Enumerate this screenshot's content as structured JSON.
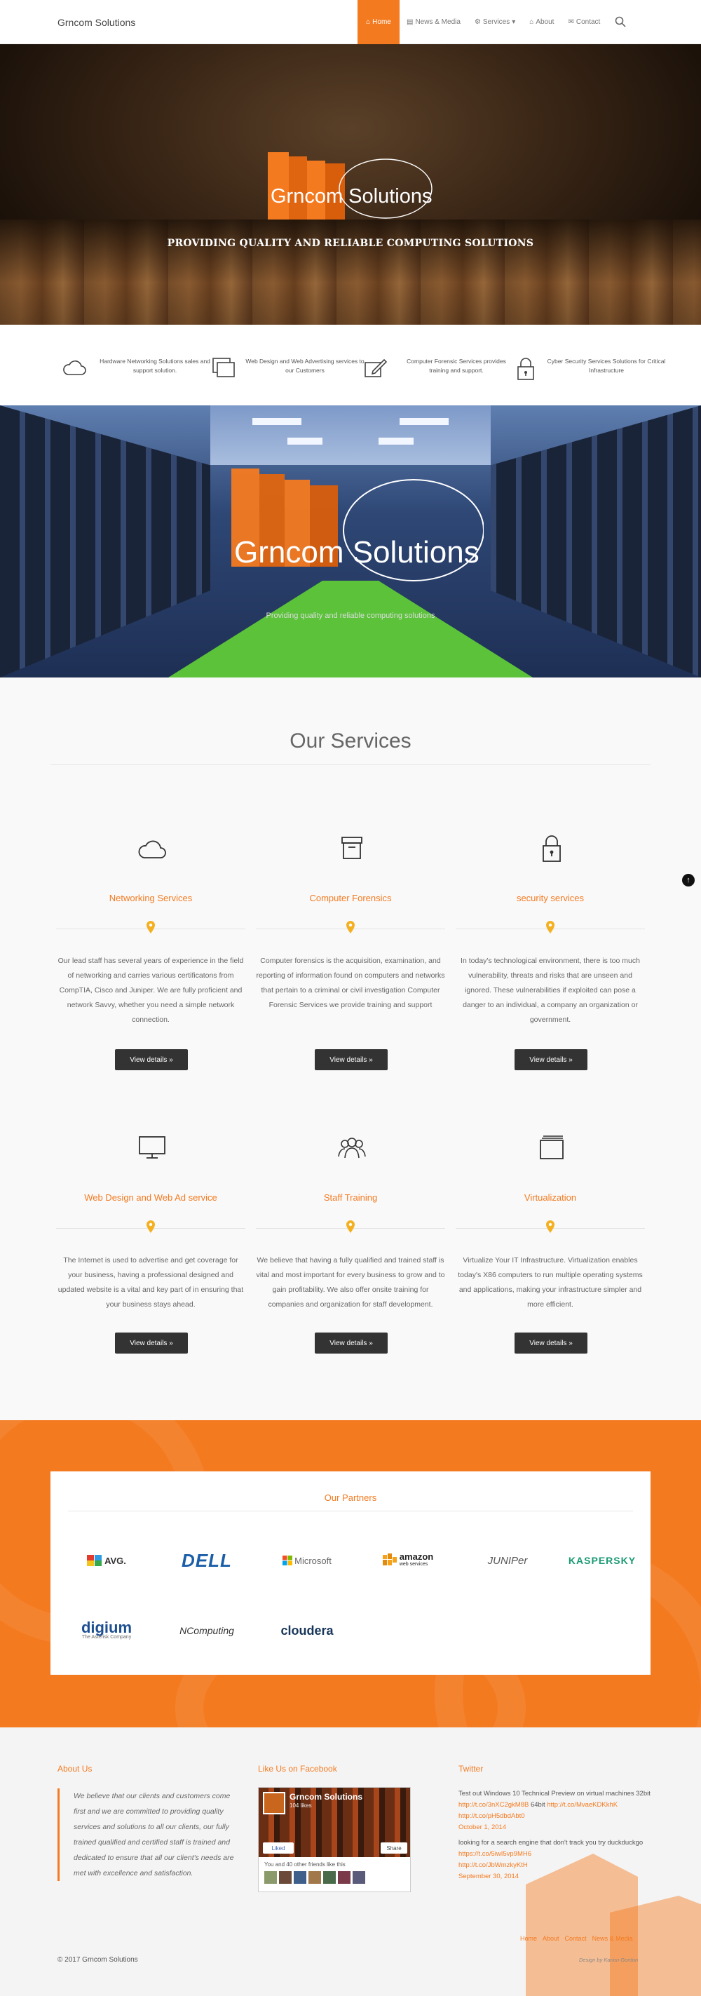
{
  "header": {
    "logo": "Grncom Solutions",
    "nav": [
      {
        "label": "Home",
        "icon": "home-icon",
        "active": true
      },
      {
        "label": "News & Media",
        "icon": "news-icon"
      },
      {
        "label": "Services",
        "icon": "gear-icon",
        "caret": "▾"
      },
      {
        "label": "About",
        "icon": "bank-icon"
      },
      {
        "label": "Contact",
        "icon": "envelope-icon"
      }
    ]
  },
  "hero1": {
    "brand": "Grncom Solutions",
    "tagline": "PROVIDING QUALITY AND RELIABLE COMPUTING SOLUTIONS"
  },
  "features": [
    {
      "icon": "cloud-icon",
      "text": "Hardware Networking Solutions sales and support solution."
    },
    {
      "icon": "windows-icon",
      "text": "Web Design and Web Advertising services to our Customers"
    },
    {
      "icon": "edit-icon",
      "text": "Computer Forensic Services provides training and support."
    },
    {
      "icon": "lock-icon",
      "text": "Cyber Security Services Solutions for Critical Infrastructure"
    }
  ],
  "hero2": {
    "brand": "Grncom Solutions",
    "tagline": "Providing quality and reliable computing solutions"
  },
  "services": {
    "title": "Our Services",
    "button_label": "View details »",
    "items": [
      {
        "icon": "cloud-icon",
        "title": "Networking Services",
        "desc": "Our lead staff has several years of experience in the field of networking and carries various certificatons from CompTIA, Cisco and Juniper. We are fully proficient and network Savvy, whether you need a simple network connection."
      },
      {
        "icon": "archive-icon",
        "title": "Computer Forensics",
        "desc": "Computer forensics is the acquisition, examination, and reporting of information found on computers and networks that pertain to a criminal or civil investigation Computer Forensic Services we provide training and support"
      },
      {
        "icon": "lock-icon",
        "title": "security services",
        "desc": "In today's technological environment, there is too much vulnerability, threats and risks that are unseen and ignored. These vulnerabilities if exploited can pose a danger to an individual, a company an organization or government."
      },
      {
        "icon": "monitor-icon",
        "title": "Web Design and Web Ad service",
        "desc": "The Internet is used to advertise and get coverage for your business, having a professional designed and updated website is a vital and key part of in ensuring that your business stays ahead."
      },
      {
        "icon": "users-icon",
        "title": "Staff Training",
        "desc": "We believe that having a fully qualified and trained staff is vital and most important for every business to grow and to gain profitability. We also offer onsite training for companies and organization for staff development."
      },
      {
        "icon": "windows-icon",
        "title": "Virtualization",
        "desc": "Virtualize Your IT Infrastructure. Virtualization enables today's X86 computers to run multiple operating systems and applications, making your infrastructure simpler and more efficient."
      }
    ]
  },
  "partners": {
    "title": "Our Partners",
    "logos": [
      "AVG.",
      "DELL",
      "Microsoft",
      "amazon",
      "web services",
      "JUNIPer",
      "KASPERSKY",
      "digium",
      "The Asterisk Company",
      "NComputing",
      "cloudera"
    ]
  },
  "footer": {
    "about_title": "About Us",
    "about_text": "We believe that our clients and customers come first and we are committed to providing quality services and solutions to all our clients, our fully trained qualified and certified staff is trained and dedicated to ensure that all our client's needs are met with excellence and satisfaction.",
    "facebook_title": "Like Us on Facebook",
    "facebook_page": "Grncom Solutions",
    "facebook_likes": "104 likes",
    "facebook_like_btn": "Liked",
    "facebook_share_btn": "Share",
    "facebook_friends": "You and 40 other friends like this",
    "twitter_title": "Twitter",
    "tweets": [
      {
        "text": "Test out Windows 10 Technical Preview on virtual machines 32bit",
        "link1": "http://t.co/3nXC2gkM8B",
        "mid": "64bit",
        "link2": "http://t.co/MvaeKDKkhK",
        "link3": "http://t.co/pH5dbdAbt0",
        "date": "October 1, 2014"
      },
      {
        "text": "looking for a search engine that don't track you try duckduckgo",
        "link1": "https://t.co/5iwI5vp9MH6",
        "link2": "http://t.co/JbWmzkyKtH",
        "date": "September 30, 2014"
      }
    ],
    "nav": [
      "Home",
      "About",
      "Contact",
      "News & Media"
    ],
    "design_by": "Design by Karion Gordon",
    "copyright": "© 2017 Grncom Solutions"
  },
  "colors": {
    "accent": "#f47a20",
    "dark_button": "#333333"
  }
}
